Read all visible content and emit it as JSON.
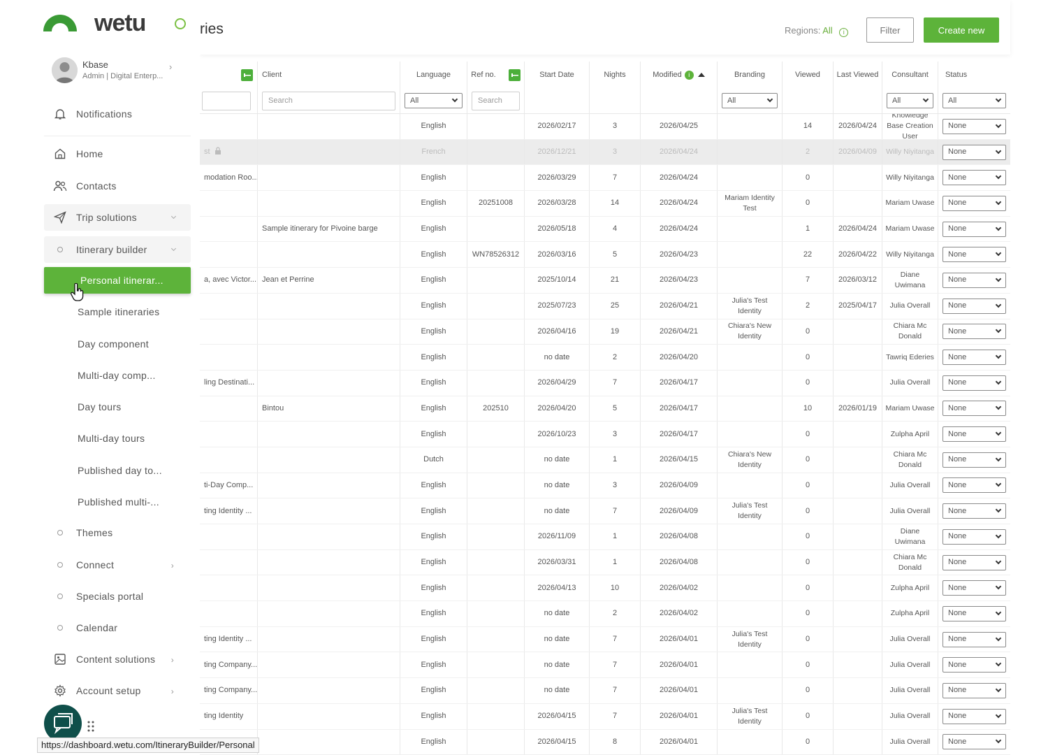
{
  "app": {
    "logo_text": "wetu"
  },
  "header": {
    "title_fragment": "ries",
    "regions_label": "Regions:",
    "regions_value": "All",
    "filter_label": "Filter",
    "create_label": "Create new"
  },
  "user": {
    "name": "Kbase",
    "role": "Admin | Digital Enterp..."
  },
  "nav": {
    "notifications": "Notifications",
    "home": "Home",
    "contacts": "Contacts",
    "trip_solutions": "Trip solutions",
    "itinerary_builder": "Itinerary builder",
    "personal": "Personal itinerar...",
    "sample": "Sample itineraries",
    "day_component": "Day component",
    "multi_day_comp": "Multi-day comp...",
    "day_tours": "Day tours",
    "multi_day_tours": "Multi-day tours",
    "published_day": "Published day to...",
    "published_multi": "Published multi-...",
    "themes": "Themes",
    "connect": "Connect",
    "specials": "Specials portal",
    "calendar": "Calendar",
    "content_solutions": "Content solutions",
    "account_setup": "Account setup"
  },
  "status_url": "https://dashboard.wetu.com/ItineraryBuilder/Personal",
  "table": {
    "headers": {
      "client": "Client",
      "language": "Language",
      "ref": "Ref no.",
      "start": "Start Date",
      "nights": "Nights",
      "modified": "Modified",
      "branding": "Branding",
      "viewed": "Viewed",
      "last_viewed": "Last Viewed",
      "consultant": "Consultant",
      "status": "Status"
    },
    "filters": {
      "client_placeholder": "Search",
      "ref_placeholder": "Search",
      "language": "All",
      "branding": "All",
      "consultant": "All",
      "status": "All"
    },
    "rows": [
      {
        "name": "",
        "client": "",
        "language": "English",
        "ref": "",
        "start": "2026/02/17",
        "nights": "3",
        "modified": "2026/04/25",
        "branding": "",
        "viewed": "14",
        "last_viewed": "2026/04/24",
        "consultant": "Knowledge Base Creation User",
        "status": "None"
      },
      {
        "name": "st",
        "client": "",
        "language": "French",
        "ref": "",
        "start": "2026/12/21",
        "nights": "3",
        "modified": "2026/04/24",
        "branding": "",
        "viewed": "2",
        "last_viewed": "2026/04/09",
        "consultant": "Willy Niyitanga",
        "status": "None"
      },
      {
        "name": "modation Roo...",
        "client": "",
        "language": "English",
        "ref": "",
        "start": "2026/03/29",
        "nights": "7",
        "modified": "2026/04/24",
        "branding": "",
        "viewed": "0",
        "last_viewed": "",
        "consultant": "Willy Niyitanga",
        "status": "None"
      },
      {
        "name": "",
        "client": "",
        "language": "English",
        "ref": "20251008",
        "start": "2026/03/28",
        "nights": "14",
        "modified": "2026/04/24",
        "branding": "Mariam Identity Test",
        "viewed": "0",
        "last_viewed": "",
        "consultant": "Mariam Uwase",
        "status": "None"
      },
      {
        "name": "",
        "client": "Sample itinerary for Pivoine barge",
        "language": "English",
        "ref": "",
        "start": "2026/05/18",
        "nights": "4",
        "modified": "2026/04/24",
        "branding": "",
        "viewed": "1",
        "last_viewed": "2026/04/24",
        "consultant": "Mariam Uwase",
        "status": "None"
      },
      {
        "name": "",
        "client": "",
        "language": "English",
        "ref": "WN78526312",
        "start": "2026/03/16",
        "nights": "5",
        "modified": "2026/04/23",
        "branding": "",
        "viewed": "22",
        "last_viewed": "2026/04/22",
        "consultant": "Willy Niyitanga",
        "status": "None"
      },
      {
        "name": "a, avec Victor...",
        "client": "Jean et Perrine",
        "language": "English",
        "ref": "",
        "start": "2025/10/14",
        "nights": "21",
        "modified": "2026/04/23",
        "branding": "",
        "viewed": "7",
        "last_viewed": "2026/03/12",
        "consultant": "Diane Uwimana",
        "status": "None"
      },
      {
        "name": "",
        "client": "",
        "language": "English",
        "ref": "",
        "start": "2025/07/23",
        "nights": "25",
        "modified": "2026/04/21",
        "branding": "Julia's Test Identity",
        "viewed": "2",
        "last_viewed": "2025/04/17",
        "consultant": "Julia Overall",
        "status": "None"
      },
      {
        "name": "",
        "client": "",
        "language": "English",
        "ref": "",
        "start": "2026/04/16",
        "nights": "19",
        "modified": "2026/04/21",
        "branding": "Chiara's New Identity",
        "viewed": "0",
        "last_viewed": "",
        "consultant": "Chiara Mc Donald",
        "status": "None"
      },
      {
        "name": "",
        "client": "",
        "language": "English",
        "ref": "",
        "start": "no date",
        "nights": "2",
        "modified": "2026/04/20",
        "branding": "",
        "viewed": "0",
        "last_viewed": "",
        "consultant": "Tawriq Ederies",
        "status": "None"
      },
      {
        "name": "ling Destinati...",
        "client": "",
        "language": "English",
        "ref": "",
        "start": "2026/04/29",
        "nights": "7",
        "modified": "2026/04/17",
        "branding": "",
        "viewed": "0",
        "last_viewed": "",
        "consultant": "Julia Overall",
        "status": "None"
      },
      {
        "name": "",
        "client": "Bintou",
        "language": "English",
        "ref": "202510",
        "start": "2026/04/20",
        "nights": "5",
        "modified": "2026/04/17",
        "branding": "",
        "viewed": "10",
        "last_viewed": "2026/01/19",
        "consultant": "Mariam Uwase",
        "status": "None"
      },
      {
        "name": "",
        "client": "",
        "language": "English",
        "ref": "",
        "start": "2026/10/23",
        "nights": "3",
        "modified": "2026/04/17",
        "branding": "",
        "viewed": "0",
        "last_viewed": "",
        "consultant": "Zulpha April",
        "status": "None"
      },
      {
        "name": "",
        "client": "",
        "language": "Dutch",
        "ref": "",
        "start": "no date",
        "nights": "1",
        "modified": "2026/04/15",
        "branding": "Chiara's New Identity",
        "viewed": "0",
        "last_viewed": "",
        "consultant": "Chiara Mc Donald",
        "status": "None"
      },
      {
        "name": "ti-Day Comp...",
        "client": "",
        "language": "English",
        "ref": "",
        "start": "no date",
        "nights": "3",
        "modified": "2026/04/09",
        "branding": "",
        "viewed": "0",
        "last_viewed": "",
        "consultant": "Julia Overall",
        "status": "None"
      },
      {
        "name": "ting Identity ...",
        "client": "",
        "language": "English",
        "ref": "",
        "start": "no date",
        "nights": "7",
        "modified": "2026/04/09",
        "branding": "Julia's Test Identity",
        "viewed": "0",
        "last_viewed": "",
        "consultant": "Julia Overall",
        "status": "None"
      },
      {
        "name": "",
        "client": "",
        "language": "English",
        "ref": "",
        "start": "2026/11/09",
        "nights": "1",
        "modified": "2026/04/08",
        "branding": "",
        "viewed": "0",
        "last_viewed": "",
        "consultant": "Diane Uwimana",
        "status": "None"
      },
      {
        "name": "",
        "client": "",
        "language": "English",
        "ref": "",
        "start": "2026/03/31",
        "nights": "1",
        "modified": "2026/04/08",
        "branding": "",
        "viewed": "0",
        "last_viewed": "",
        "consultant": "Chiara Mc Donald",
        "status": "None"
      },
      {
        "name": "",
        "client": "",
        "language": "English",
        "ref": "",
        "start": "2026/04/13",
        "nights": "10",
        "modified": "2026/04/02",
        "branding": "",
        "viewed": "0",
        "last_viewed": "",
        "consultant": "Zulpha April",
        "status": "None"
      },
      {
        "name": "",
        "client": "",
        "language": "English",
        "ref": "",
        "start": "no date",
        "nights": "2",
        "modified": "2026/04/02",
        "branding": "",
        "viewed": "0",
        "last_viewed": "",
        "consultant": "Zulpha April",
        "status": "None"
      },
      {
        "name": "ting Identity ...",
        "client": "",
        "language": "English",
        "ref": "",
        "start": "no date",
        "nights": "7",
        "modified": "2026/04/01",
        "branding": "Julia's Test Identity",
        "viewed": "0",
        "last_viewed": "",
        "consultant": "Julia Overall",
        "status": "None"
      },
      {
        "name": "ting Company...",
        "client": "",
        "language": "English",
        "ref": "",
        "start": "no date",
        "nights": "7",
        "modified": "2026/04/01",
        "branding": "",
        "viewed": "0",
        "last_viewed": "",
        "consultant": "Julia Overall",
        "status": "None"
      },
      {
        "name": "ting Company...",
        "client": "",
        "language": "English",
        "ref": "",
        "start": "no date",
        "nights": "7",
        "modified": "2026/04/01",
        "branding": "",
        "viewed": "0",
        "last_viewed": "",
        "consultant": "Julia Overall",
        "status": "None"
      },
      {
        "name": "ting Identity",
        "client": "",
        "language": "English",
        "ref": "",
        "start": "2026/04/15",
        "nights": "7",
        "modified": "2026/04/01",
        "branding": "Julia's Test Identity",
        "viewed": "0",
        "last_viewed": "",
        "consultant": "Julia Overall",
        "status": "None"
      },
      {
        "name": "",
        "client": "",
        "language": "English",
        "ref": "",
        "start": "2026/04/15",
        "nights": "8",
        "modified": "2026/04/01",
        "branding": "",
        "viewed": "0",
        "last_viewed": "",
        "consultant": "Julia Overall",
        "status": "None"
      }
    ]
  }
}
